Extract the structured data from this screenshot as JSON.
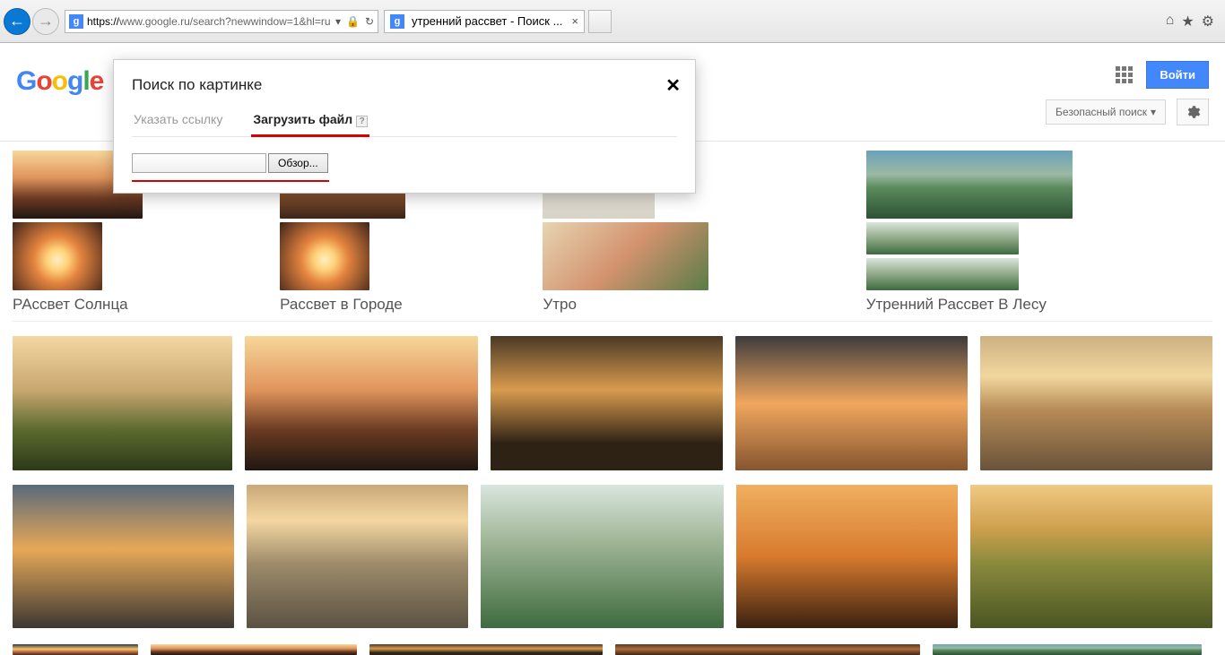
{
  "browser": {
    "url_prefix": "https://",
    "url_rest": "www.google.ru/search?newwindow=1&hl=ru",
    "tab_title": "утренний рассвет - Поиск ...",
    "favicon_letter": "g"
  },
  "window_buttons": {
    "min": "—",
    "max": "❐",
    "close": "✕"
  },
  "ie_icons": {
    "home": "⌂",
    "star": "★",
    "gear": "⚙"
  },
  "google": {
    "logo": {
      "g1": "G",
      "o1": "o",
      "o2": "o",
      "g2": "g",
      "l": "l",
      "e": "e"
    },
    "signin": "Войти",
    "safe_search": "Безопасный поиск",
    "dropdown_caret": "▾"
  },
  "sbi": {
    "title": "Поиск по картинке",
    "close": "✕",
    "tab_url": "Указать ссылку",
    "tab_upload": "Загрузить файл",
    "browse": "Обзор...",
    "help": "?"
  },
  "related": [
    {
      "label": "РАссвет Солнца"
    },
    {
      "label": "Рассвет в Городе"
    },
    {
      "label": "Утро"
    },
    {
      "label": "Утренний Рассвет В Лесу"
    }
  ]
}
